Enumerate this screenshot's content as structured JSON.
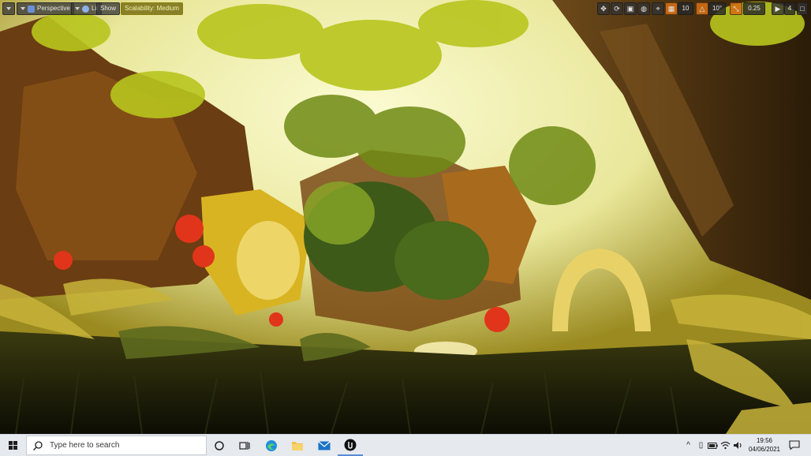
{
  "viewport": {
    "toolbar_left": {
      "view_mode": "Perspective",
      "lighting": "Lit",
      "show": "Show",
      "scalability": "Scalability: Medium"
    },
    "toolbar_right": {
      "grid_snap_value": "10",
      "rotation_snap_value": "10°",
      "scale_snap_value": "0.25",
      "camera_speed_value": "4"
    },
    "colors": {
      "toolbar_accent": "#d46e14",
      "scalability_badge": "#786e14"
    }
  },
  "taskbar": {
    "search_placeholder": "Type here to search",
    "apps": [
      "task-view",
      "edge",
      "file-explorer",
      "mail",
      "unreal-engine"
    ],
    "clock": {
      "time": "19:56",
      "date": "04/06/2021"
    }
  }
}
